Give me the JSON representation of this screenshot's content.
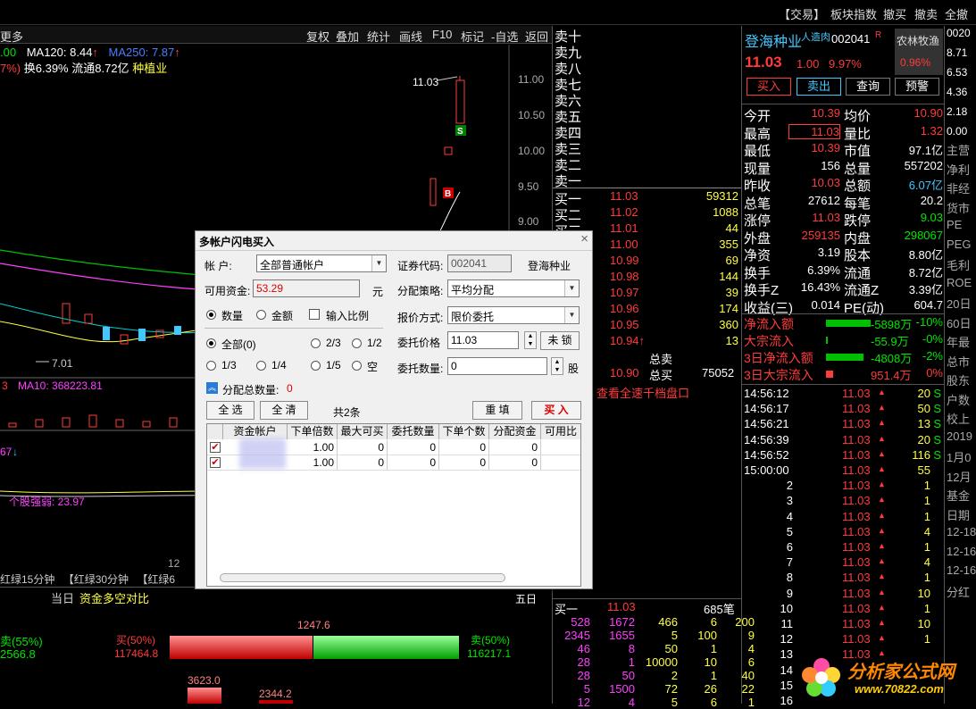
{
  "topbar": {
    "items": [
      "【交易】",
      "板块指数",
      "撤买",
      "撤卖",
      "全撤"
    ]
  },
  "chartbar": {
    "more": "更多",
    "items": [
      "复权",
      "叠加",
      "统计",
      "画线",
      "F10",
      "标记",
      "-自选",
      "返回"
    ]
  },
  "indicators": {
    "line1_a": ".00",
    "ma120": "MA120: 8.44",
    "ma250": "MA250: 7.87",
    "line2_a": "7%)",
    "turnover": "换6.39%",
    "float": "流通8.72亿",
    "sector": "种植业"
  },
  "price_axis": [
    "11.00",
    "10.50",
    "10.00",
    "9.50",
    "9.00"
  ],
  "chart_labels": {
    "high": "11.03",
    "low": "7.01",
    "b_marker": "B",
    "s_marker": "S",
    "vol_ma": "MA10: 368223.81",
    "vol_arrow": "3",
    "ind3": "67",
    "ind4": "个股强弱: 23.97",
    "axis_12": "12"
  },
  "bottom_tabs": [
    "红绿15分钟",
    "【红绿30分钟",
    "【红绿6"
  ],
  "flow": {
    "tab_today": "当日",
    "tab_title": "资金多空对比",
    "total": "1247.6",
    "left_sell": "卖(55%)",
    "left_val": "2566.8",
    "buy_label": "买(50%)",
    "buy_val": "117464.8",
    "sell_label": "卖(50%)",
    "sell_val": "116217.1",
    "bar1": "3623.0",
    "bar2": "2344.2",
    "five": "五日"
  },
  "sell_levels": [
    "卖十",
    "卖九",
    "卖八",
    "卖七",
    "卖六",
    "卖五",
    "卖四",
    "卖三",
    "卖二",
    "卖一"
  ],
  "buy_levels": [
    {
      "label": "买一",
      "price": "11.03",
      "vol": "59312"
    },
    {
      "label": "买二",
      "price": "11.02",
      "vol": "1088"
    },
    {
      "label": "买三",
      "price": "11.01",
      "vol": "44"
    },
    {
      "label": "买四",
      "price": "11.00",
      "vol": "355"
    },
    {
      "label": "",
      "price": "10.99",
      "vol": "69"
    },
    {
      "label": "",
      "price": "10.98",
      "vol": "144"
    },
    {
      "label": "",
      "price": "10.97",
      "vol": "39"
    },
    {
      "label": "",
      "price": "10.96",
      "vol": "174"
    },
    {
      "label": "",
      "price": "10.95",
      "vol": "360"
    },
    {
      "label": "",
      "price": "10.94↑",
      "vol": "13"
    }
  ],
  "order_summary": {
    "total_sell": "总卖",
    "total_buy_price": "10.90",
    "total_buy": "总买",
    "total_buy_vol": "75052",
    "link": "查看全速千档盘口"
  },
  "bottom_book": {
    "label": "买一",
    "price": "11.03",
    "vol": "685笔",
    "rows": [
      [
        "528",
        "1672",
        "466",
        "6",
        "200"
      ],
      [
        "2345",
        "1655",
        "5",
        "100",
        "9"
      ],
      [
        "46",
        "8",
        "50",
        "1",
        "4"
      ],
      [
        "28",
        "1",
        "10000",
        "10",
        "6"
      ],
      [
        "28",
        "50",
        "2",
        "1",
        "40"
      ],
      [
        "5",
        "1500",
        "72",
        "26",
        "22"
      ],
      [
        "12",
        "4",
        "5",
        "6",
        "1"
      ]
    ]
  },
  "stock": {
    "name": "登海种业",
    "tag": "人造肉",
    "code": "002041",
    "r": "R",
    "price": "11.03",
    "change": "1.00",
    "pct": "9.97%",
    "sector": "农林牧渔",
    "sector_pct": "0.96%",
    "btn_buy": "买入",
    "btn_sell": "卖出",
    "btn_query": "查询",
    "btn_alert": "预警"
  },
  "quote_rows": [
    {
      "l": "今开",
      "lv": "10.39",
      "r": "均价",
      "rv": "10.90"
    },
    {
      "l": "最高",
      "lv": "11.03",
      "r": "量比",
      "rv": "1.32"
    },
    {
      "l": "最低",
      "lv": "10.39",
      "r": "市值",
      "rv": "97.1亿"
    },
    {
      "l": "现量",
      "lv": "156",
      "r": "总量",
      "rv": "557202"
    },
    {
      "l": "昨收",
      "lv": "10.03",
      "r": "总额",
      "rv": "6.07亿"
    },
    {
      "l": "总笔",
      "lv": "27612",
      "r": "每笔",
      "rv": "20.2"
    },
    {
      "l": "涨停",
      "lv": "11.03",
      "r": "跌停",
      "rv": "9.03"
    },
    {
      "l": "外盘",
      "lv": "259135",
      "r": "内盘",
      "rv": "298067"
    },
    {
      "l": "净资",
      "lv": "3.19",
      "r": "股本",
      "rv": "8.80亿"
    },
    {
      "l": "换手",
      "lv": "6.39%",
      "r": "流通",
      "rv": "8.72亿"
    },
    {
      "l": "换手Z",
      "lv": "16.43%",
      "r": "流通Z",
      "rv": "3.39亿"
    },
    {
      "l": "收益(三)",
      "lv": "0.014",
      "r": "PE(动)",
      "rv": "604.7"
    }
  ],
  "flow_rows": [
    {
      "l": "净流入额",
      "v": "-5898万",
      "p": "-10%"
    },
    {
      "l": "大宗流入",
      "v": "-55.9万",
      "p": "-0%"
    },
    {
      "l": "3日净流入额",
      "v": "-4808万",
      "p": "-2%"
    },
    {
      "l": "3日大宗流入",
      "v": "951.4万",
      "p": "0%"
    }
  ],
  "ticks": [
    {
      "t": "14:56:12",
      "p": "11.03",
      "v": "20",
      "f": "S"
    },
    {
      "t": "14:56:17",
      "p": "11.03",
      "v": "50",
      "f": "S"
    },
    {
      "t": "14:56:21",
      "p": "11.03",
      "v": "13",
      "f": "S"
    },
    {
      "t": "14:56:39",
      "p": "11.03",
      "v": "20",
      "f": "S"
    },
    {
      "t": "14:56:52",
      "p": "11.03",
      "v": "116",
      "f": "S"
    },
    {
      "t": "15:00:00",
      "p": "11.03",
      "v": "55",
      "f": ""
    },
    {
      "t": "2",
      "p": "11.03",
      "v": "1",
      "f": ""
    },
    {
      "t": "3",
      "p": "11.03",
      "v": "1",
      "f": ""
    },
    {
      "t": "4",
      "p": "11.03",
      "v": "1",
      "f": ""
    },
    {
      "t": "5",
      "p": "11.03",
      "v": "4",
      "f": ""
    },
    {
      "t": "6",
      "p": "11.03",
      "v": "1",
      "f": ""
    },
    {
      "t": "7",
      "p": "11.03",
      "v": "4",
      "f": ""
    },
    {
      "t": "8",
      "p": "11.03",
      "v": "1",
      "f": ""
    },
    {
      "t": "9",
      "p": "11.03",
      "v": "10",
      "f": ""
    },
    {
      "t": "10",
      "p": "11.03",
      "v": "1",
      "f": ""
    },
    {
      "t": "11",
      "p": "11.03",
      "v": "10",
      "f": ""
    },
    {
      "t": "12",
      "p": "11.03",
      "v": "1",
      "f": ""
    },
    {
      "t": "13",
      "p": "11.03",
      "v": "",
      "f": ""
    },
    {
      "t": "14",
      "p": "",
      "v": "",
      "f": ""
    },
    {
      "t": "15",
      "p": "",
      "v": "",
      "f": ""
    },
    {
      "t": "16",
      "p": "",
      "v": "",
      "f": ""
    }
  ],
  "farright": {
    "top": [
      "0020",
      "8.71",
      "6.53",
      "4.36",
      "2.18",
      "0.00"
    ],
    "items": [
      "主营",
      "净利",
      "非经",
      "货市",
      "PE",
      "PEG",
      "毛利",
      "ROE",
      "20日",
      "60日",
      "年最",
      "总市",
      "股东",
      "户数",
      "校上",
      "2019",
      "1月0",
      "12月",
      "基金",
      "日期",
      "12-18",
      "12-16",
      "12-16",
      "分红"
    ]
  },
  "dialog": {
    "title": "多帐户闪电买入",
    "acct_label": "帐   户:",
    "acct_value": "全部普通帐户",
    "cash_label": "可用资金:",
    "cash_value": "53.29",
    "cash_unit": "元",
    "code_label": "证券代码:",
    "code_value": "002041",
    "code_name": "登海种业",
    "strategy_label": "分配策略:",
    "strategy_value": "平均分配",
    "price_type_label": "报价方式:",
    "price_type_value": "限价委托",
    "price_label": "委托价格",
    "price_value": "11.03",
    "lock_label": "未 锁",
    "qty_label": "委托数量:",
    "qty_value": "0",
    "qty_unit": "股",
    "mode_qty": "数量",
    "mode_amt": "金额",
    "input_ratio": "输入比例",
    "ratios": [
      "全部(0)",
      "2/3",
      "1/2",
      "1/3",
      "1/4",
      "1/5",
      "空"
    ],
    "alloc_label": "分配总数量:",
    "alloc_value": "0",
    "btn_select_all": "全 选",
    "btn_clear_all": "全 清",
    "total_count": "共2条",
    "btn_refill": "重 填",
    "btn_buy": "买 入",
    "columns": [
      "资金帐户",
      "下单倍数",
      "最大可买",
      "委托数量",
      "下单个数",
      "分配资金",
      "可用比"
    ],
    "rows": [
      [
        "1.00",
        "0",
        "0",
        "0",
        "0"
      ],
      [
        "1.00",
        "0",
        "0",
        "0",
        "0"
      ]
    ]
  },
  "watermark": {
    "text": "分析家公式网",
    "url": "www.70822.com"
  }
}
